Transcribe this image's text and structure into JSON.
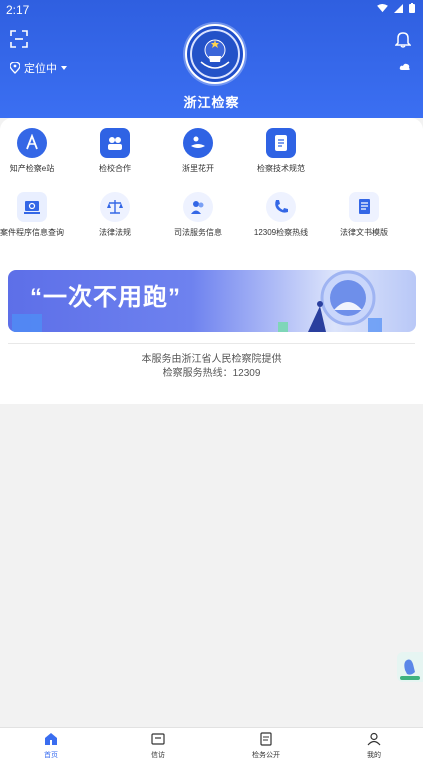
{
  "status_bar": {
    "time": "2:17"
  },
  "header": {
    "location_label": "定位中",
    "title": "浙江检察",
    "accent_color": "#3a6df0"
  },
  "services": [
    {
      "label": "知产检察e站",
      "icon": "knowledge-icon"
    },
    {
      "label": "检校合作",
      "icon": "cooperation-icon"
    },
    {
      "label": "浙里花开",
      "icon": "flower-icon"
    },
    {
      "label": "检察技术规范",
      "icon": "document-icon"
    },
    {
      "label": "案件程序信息查询",
      "icon": "case-search-icon"
    },
    {
      "label": "法律法规",
      "icon": "scales-icon"
    },
    {
      "label": "司法服务信息",
      "icon": "service-people-icon"
    },
    {
      "label": "12309检察热线",
      "icon": "phone-icon"
    },
    {
      "label": "法律文书模版",
      "icon": "template-icon"
    }
  ],
  "banner": {
    "slogan": "“一次不用跑”"
  },
  "footer_info": {
    "line1": "本服务由浙江省人民检察院提供",
    "line2": "检察服务热线：12309"
  },
  "tabbar": [
    {
      "label": "首页",
      "icon": "home-icon",
      "active": true
    },
    {
      "label": "信访",
      "icon": "mail-icon",
      "active": false
    },
    {
      "label": "检务公开",
      "icon": "doc-public-icon",
      "active": false
    },
    {
      "label": "我的",
      "icon": "user-icon",
      "active": false
    }
  ]
}
